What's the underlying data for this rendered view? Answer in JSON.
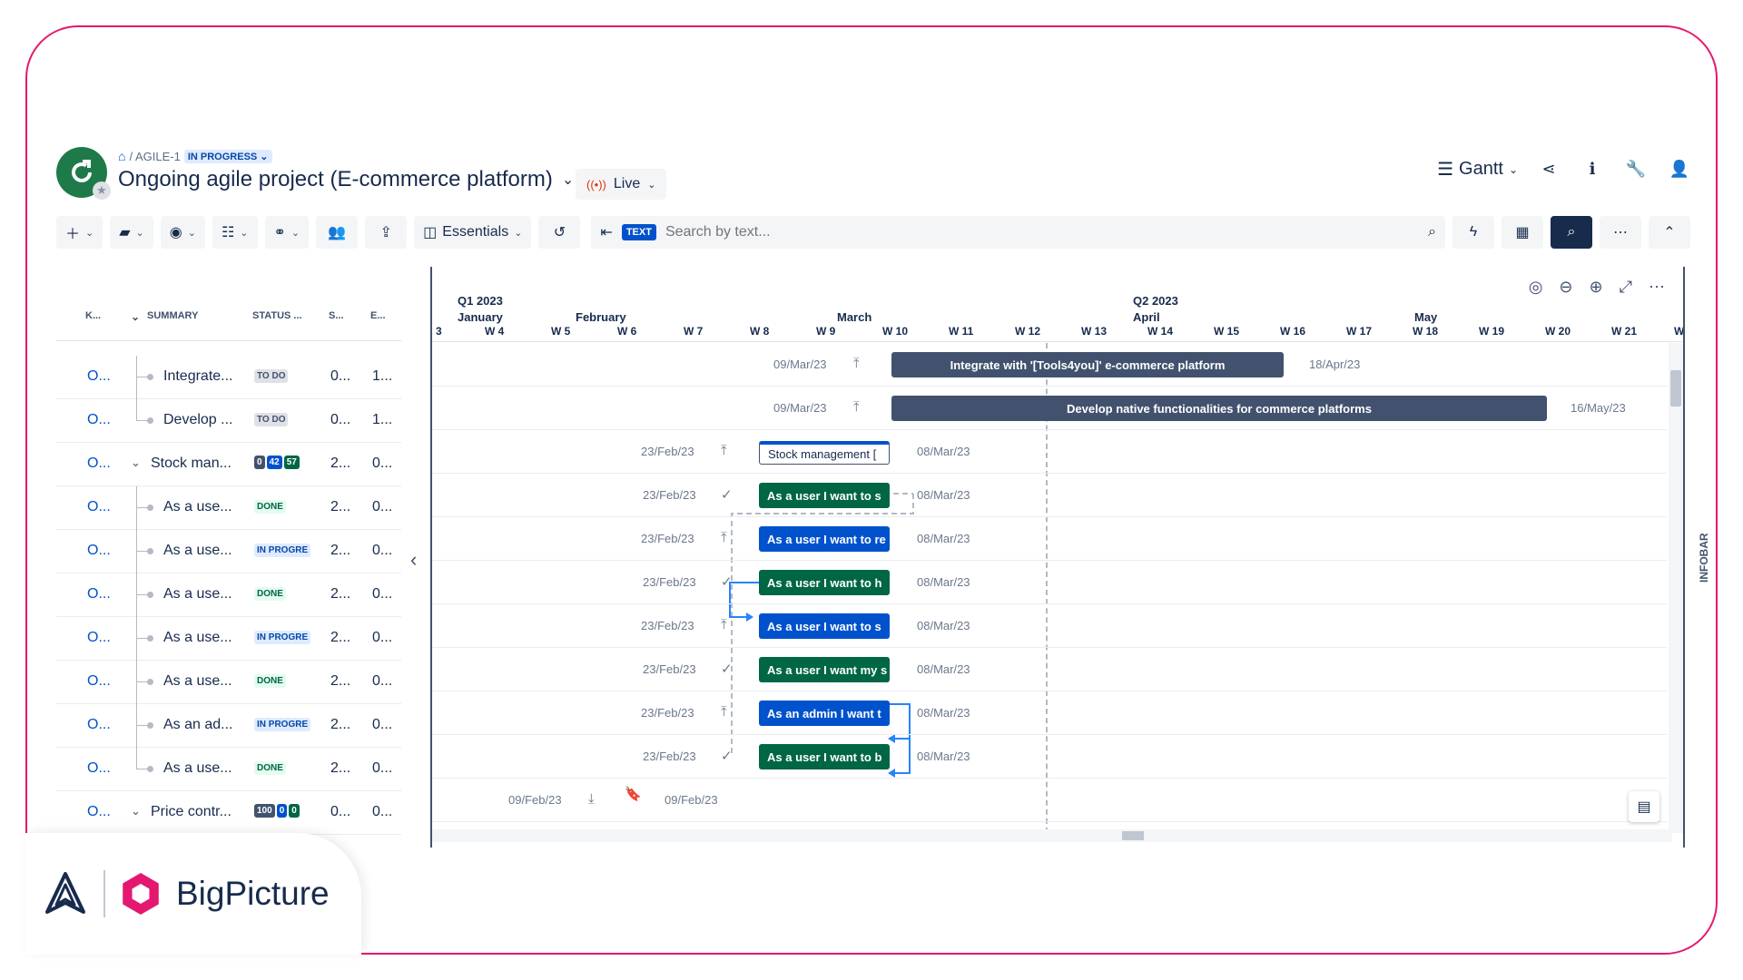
{
  "header": {
    "breadcrumb_key": "/ AGILE-1",
    "breadcrumb_status": "IN PROGRESS",
    "project_title": "Ongoing agile project (E-commerce platform)",
    "live_label": "Live",
    "view_label": "Gantt"
  },
  "toolbar": {
    "essentials_label": "Essentials",
    "search_tag": "TEXT",
    "search_placeholder": "Search by text..."
  },
  "grid": {
    "columns": [
      "K...",
      "SUMMARY",
      "STATUS ...",
      "S...",
      "E..."
    ],
    "rows": [
      {
        "key": "O...",
        "summary": "Integrate...",
        "status": "TO DO",
        "start": "0...",
        "end": "1..."
      },
      {
        "key": "O...",
        "summary": "Develop ...",
        "status": "TO DO",
        "start": "0...",
        "end": "1..."
      },
      {
        "key": "O...",
        "summary": "Stock man...",
        "mini": [
          "0",
          "42",
          "57"
        ],
        "start": "2...",
        "end": "0..."
      },
      {
        "key": "O...",
        "summary": "As a use...",
        "status": "DONE",
        "start": "2...",
        "end": "0..."
      },
      {
        "key": "O...",
        "summary": "As a use...",
        "status": "IN PROGRE",
        "start": "2...",
        "end": "0..."
      },
      {
        "key": "O...",
        "summary": "As a use...",
        "status": "DONE",
        "start": "2...",
        "end": "0..."
      },
      {
        "key": "O...",
        "summary": "As a use...",
        "status": "IN PROGRE",
        "start": "2...",
        "end": "0..."
      },
      {
        "key": "O...",
        "summary": "As a use...",
        "status": "DONE",
        "start": "2...",
        "end": "0..."
      },
      {
        "key": "O...",
        "summary": "As an ad...",
        "status": "IN PROGRE",
        "start": "2...",
        "end": "0..."
      },
      {
        "key": "O...",
        "summary": "As a use...",
        "status": "DONE",
        "start": "2...",
        "end": "0..."
      },
      {
        "key": "O...",
        "summary": "Price contr...",
        "mini": [
          "100",
          "0",
          "0"
        ],
        "start": "0...",
        "end": "0..."
      }
    ]
  },
  "timeline": {
    "quarters": [
      "Q1 2023",
      "Q2 2023"
    ],
    "months": [
      "January",
      "February",
      "March",
      "April",
      "May"
    ],
    "weeks": [
      "3",
      "W 4",
      "W 5",
      "W 6",
      "W 7",
      "W 8",
      "W 9",
      "W 10",
      "W 11",
      "W 12",
      "W 13",
      "W 14",
      "W 15",
      "W 16",
      "W 17",
      "W 18",
      "W 19",
      "W 20",
      "W 21",
      "W"
    ]
  },
  "gantt": {
    "bars": [
      {
        "start_date": "09/Mar/23",
        "end_date": "18/Apr/23",
        "label": "Integrate with '[Tools4you]' e-commerce platform"
      },
      {
        "start_date": "09/Mar/23",
        "end_date": "16/May/23",
        "label": "Develop native functionalities for commerce platforms"
      },
      {
        "start_date": "23/Feb/23",
        "end_date": "08/Mar/23",
        "label": "Stock management ["
      },
      {
        "start_date": "23/Feb/23",
        "end_date": "08/Mar/23",
        "label": "As a user I want to s"
      },
      {
        "start_date": "23/Feb/23",
        "end_date": "08/Mar/23",
        "label": "As a user I want to re"
      },
      {
        "start_date": "23/Feb/23",
        "end_date": "08/Mar/23",
        "label": "As a user I want to h"
      },
      {
        "start_date": "23/Feb/23",
        "end_date": "08/Mar/23",
        "label": "As a user I want to s"
      },
      {
        "start_date": "23/Feb/23",
        "end_date": "08/Mar/23",
        "label": "As a user I want my s"
      },
      {
        "start_date": "23/Feb/23",
        "end_date": "08/Mar/23",
        "label": "As an admin I want t"
      },
      {
        "start_date": "23/Feb/23",
        "end_date": "08/Mar/23",
        "label": "As a user I want to b"
      },
      {
        "start_date": "09/Feb/23",
        "end_date": "09/Feb/23",
        "label": ""
      }
    ]
  },
  "infobar_label": "INFOBAR",
  "brand": {
    "name": "BigPicture"
  },
  "colors": {
    "accent": "#0052cc",
    "done": "#006644",
    "epic": "#42526e",
    "frame": "#e5186f"
  }
}
